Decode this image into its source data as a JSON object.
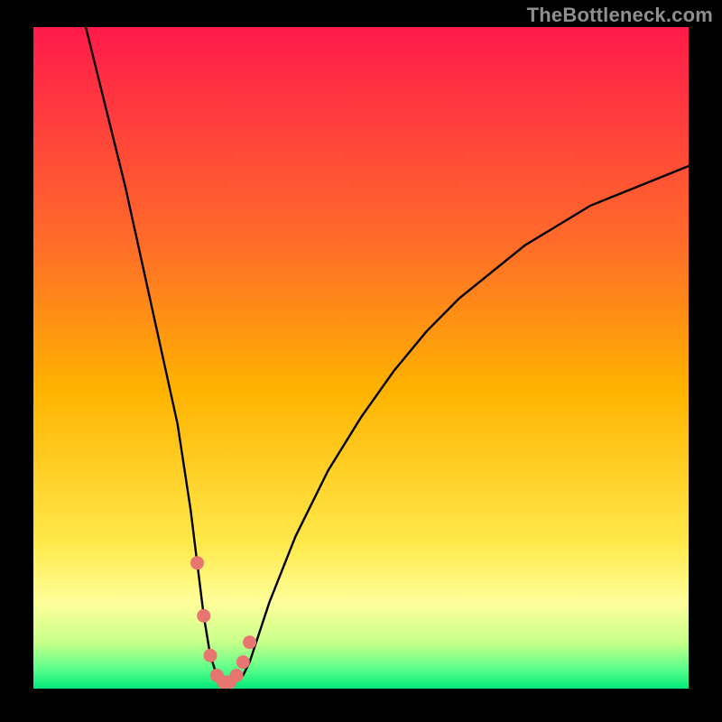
{
  "watermark": "TheBottleneck.com",
  "colors": {
    "frame": "#000000",
    "curve": "#000000",
    "marker": "#e6766f",
    "grad_top": "#ff1a4b",
    "grad_mid": "#ffb300",
    "grad_yellow": "#ffff66",
    "grad_green_light": "#7bff7b",
    "grad_green": "#00e87a"
  },
  "chart_data": {
    "type": "line",
    "title": "",
    "xlabel": "",
    "ylabel": "",
    "xlim": [
      0,
      100
    ],
    "ylim": [
      0,
      100
    ],
    "series": [
      {
        "name": "bottleneck-curve",
        "x": [
          8,
          10,
          12,
          14,
          16,
          18,
          20,
          22,
          24,
          25,
          26,
          27,
          28,
          29,
          30,
          32,
          33,
          34,
          36,
          40,
          45,
          50,
          55,
          60,
          65,
          70,
          75,
          80,
          85,
          90,
          95,
          100
        ],
        "y": [
          100,
          92,
          84,
          76,
          67,
          58,
          49,
          40,
          27,
          19,
          11,
          5,
          2,
          1,
          1,
          2,
          4,
          7,
          13,
          23,
          33,
          41,
          48,
          54,
          59,
          63,
          67,
          70,
          73,
          75,
          77,
          79
        ]
      }
    ],
    "markers": {
      "name": "highlight-range",
      "x": [
        25,
        26,
        27,
        28,
        29,
        30,
        31,
        32,
        33
      ],
      "y": [
        19,
        11,
        5,
        2,
        1,
        1,
        2,
        4,
        7
      ]
    },
    "annotations": []
  }
}
